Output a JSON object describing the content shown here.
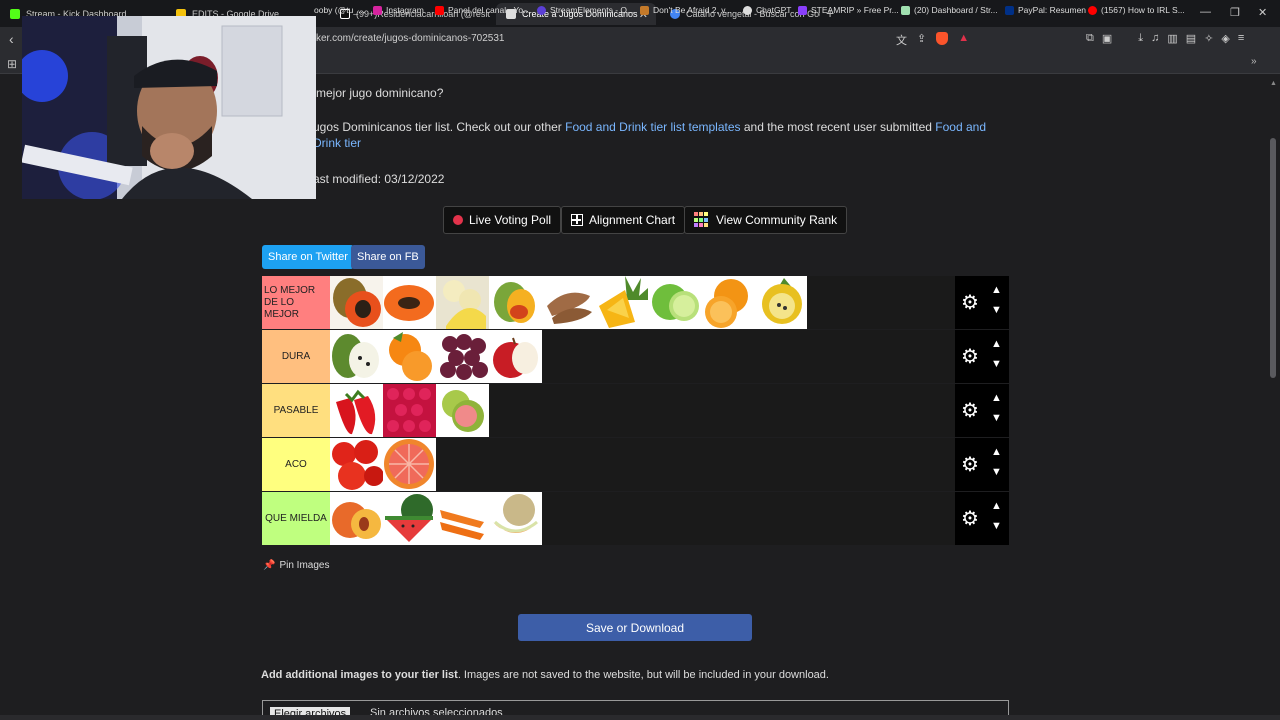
{
  "tabs": [
    {
      "title": "Stream - Kick Dashboard",
      "color": "#53fc18"
    },
    {
      "title": "EDITS - Google Drive",
      "color": "#f4c20d"
    },
    {
      "title": "(99+)Residenciacarrilloan (@residen",
      "color": "#ffffff"
    },
    {
      "title": "Create a Jugos Dominicanos Tier",
      "color": "#e0e0e0"
    },
    {
      "title": "Cataño vengetal - Buscar con Google",
      "color": "#4285f4"
    }
  ],
  "url": "ker.com/create/jugos-dominicanos-702531",
  "bookmarks": [
    "ooby (@tu_...",
    "Instagram",
    "Panel del canal - Yo...",
    "StreamElements - O...",
    "Don't Be Afraid 2, v...",
    "ChatGPT",
    "STEAMRIP » Free Pr...",
    "(20) Dashboard / Str...",
    "PayPal: Resumen",
    "(1567) How to IRL S..."
  ],
  "page": {
    "question": "mejor jugo dominicano?",
    "desc_prefix": "ugos Dominicanos tier list. Check out our other ",
    "desc_link1": "Food and Drink tier list templates",
    "desc_middle": " and the most recent user submitted ",
    "desc_link2": "Food and Drink tier",
    "modified": "ast modified: 03/12/2022",
    "buttons": {
      "live_poll": "Live Voting Poll",
      "alignment": "Alignment Chart",
      "community": "View Community Rank"
    },
    "share_twitter": "Share on Twitter",
    "share_fb": "Share on FB",
    "pin_images": "Pin Images",
    "save": "Save or Download",
    "add_images_bold": "Add additional images to your tier list",
    "add_images_rest": ". Images are not saved to the website, but will be included in your download.",
    "file_button": "Elegir archivos",
    "file_status": "Sin archivos seleccionados"
  },
  "tiers": [
    {
      "label": "LO MEJOR DE LO MEJOR",
      "color": "#ff7f7f",
      "items": [
        "papaya",
        "papaya-halves",
        "banana",
        "mango",
        "tamarind",
        "pineapple",
        "lime",
        "orange",
        "passion-fruit"
      ]
    },
    {
      "label": "DURA",
      "color": "#ffbf7f",
      "items": [
        "soursop",
        "tangerine",
        "grapes",
        "apple"
      ]
    },
    {
      "label": "PASABLE",
      "color": "#ffdf7f",
      "items": [
        "strawberry",
        "raspberry",
        "guava"
      ]
    },
    {
      "label": "ACO",
      "color": "#ffff7f",
      "items": [
        "tomato",
        "grapefruit"
      ]
    },
    {
      "label": "QUE MIELDA",
      "color": "#bfff7f",
      "items": [
        "peach",
        "watermelon",
        "carrot",
        "cantaloupe"
      ]
    }
  ]
}
